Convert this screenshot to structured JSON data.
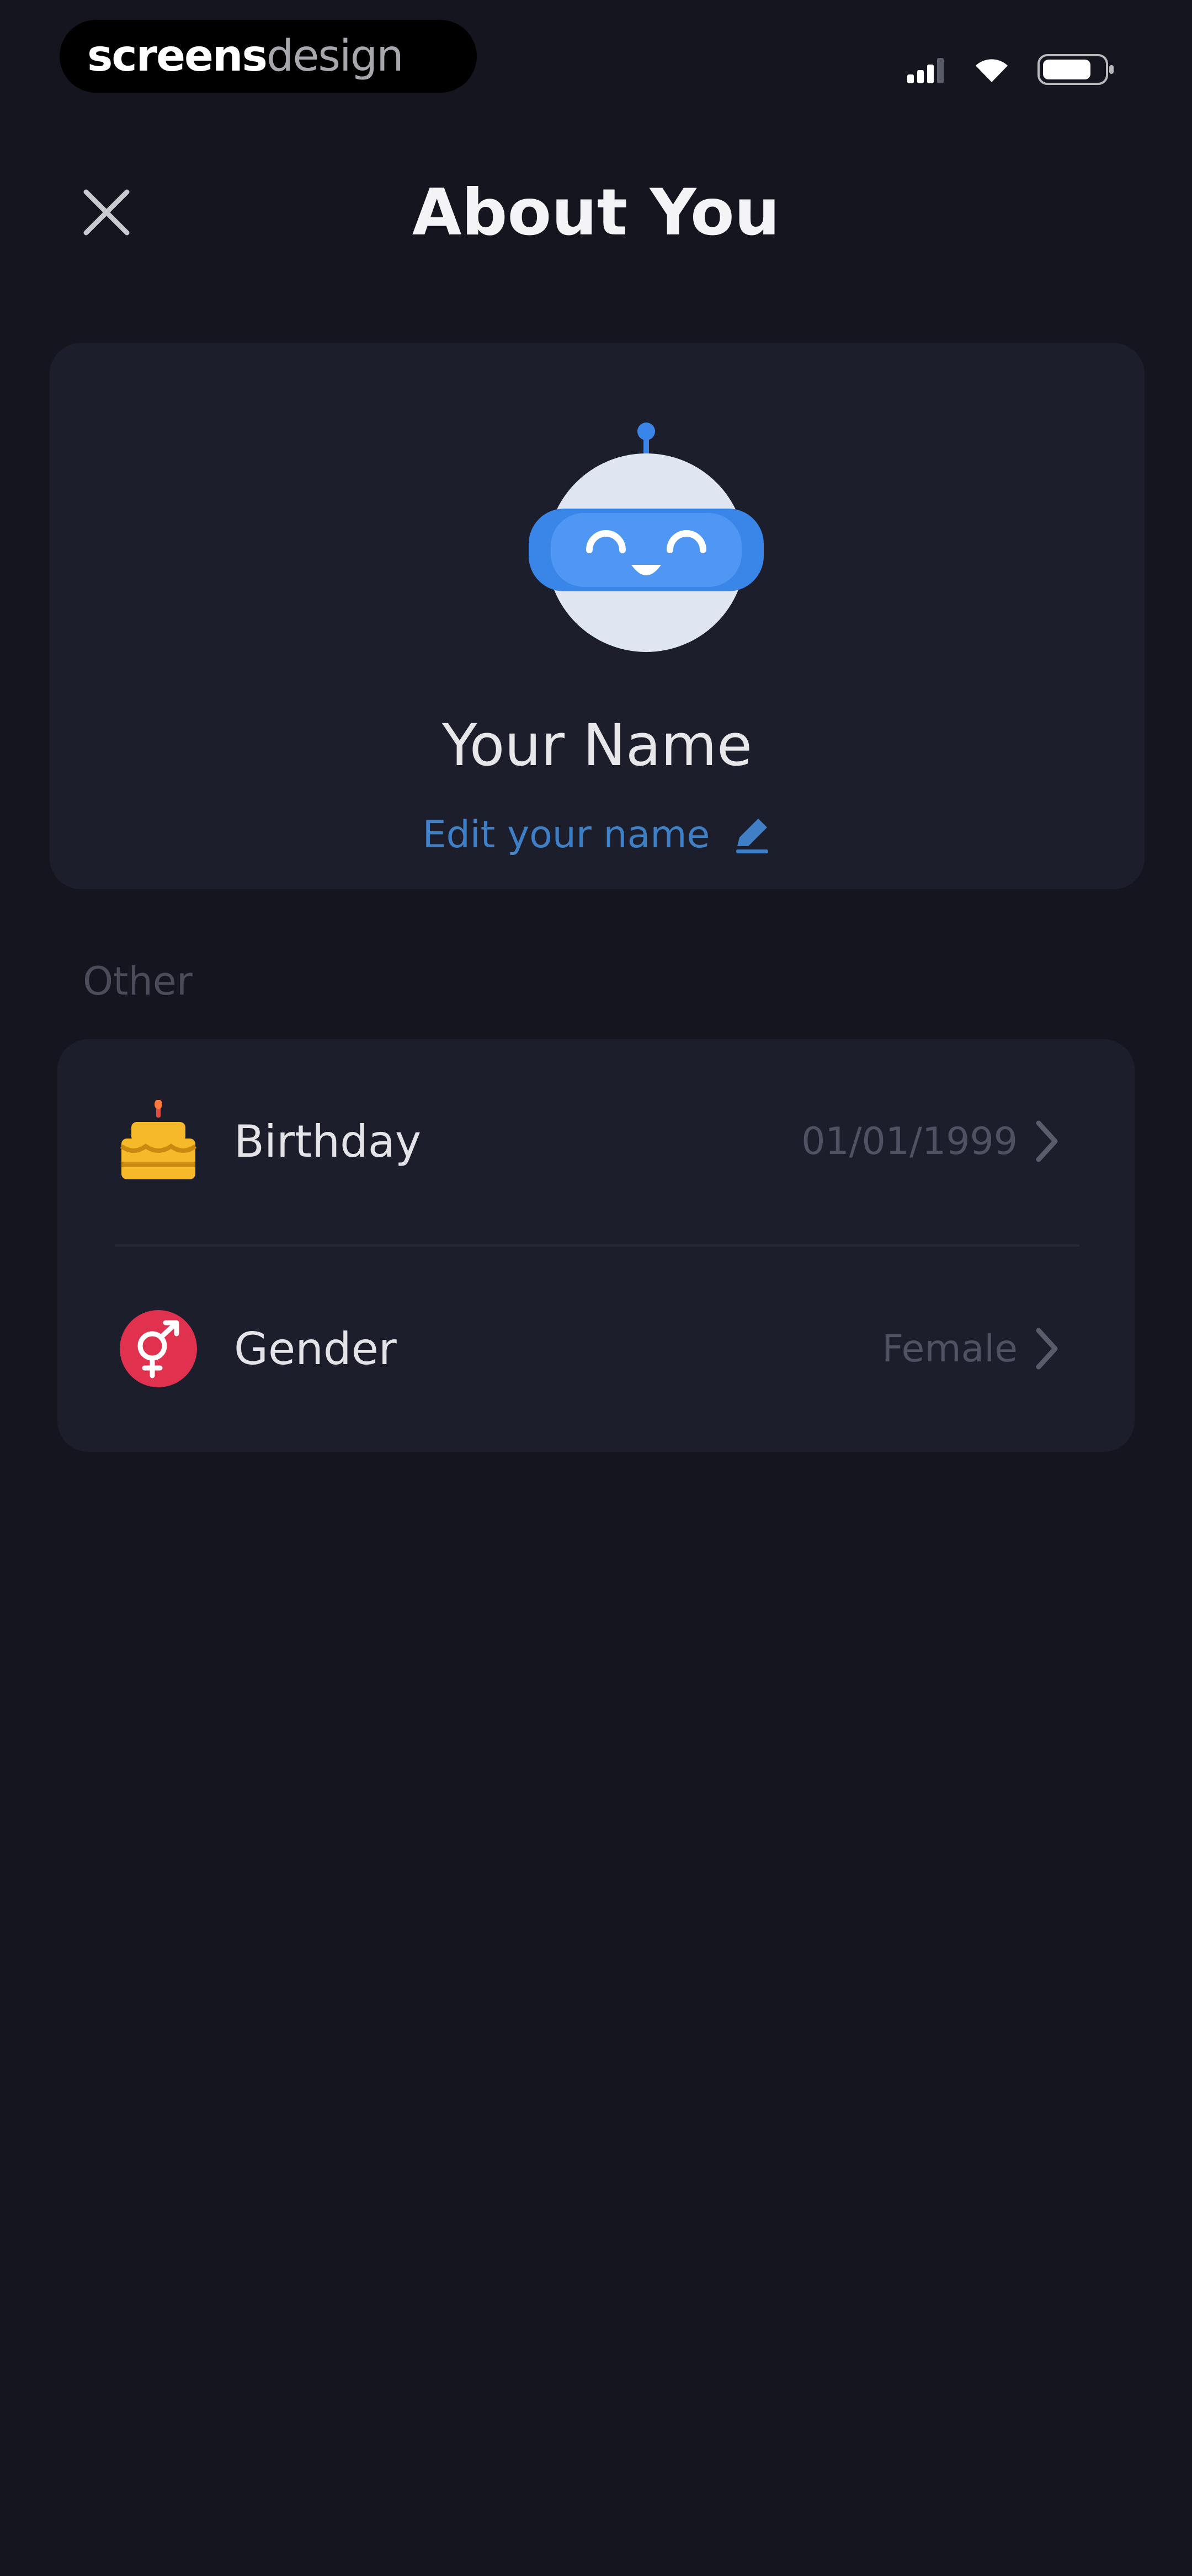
{
  "status_bar": {
    "brand_part1": "screens",
    "brand_part2": "design",
    "icons": [
      "signal-icon",
      "wifi-icon",
      "battery-icon"
    ]
  },
  "header": {
    "title": "About You",
    "close_icon": "close-icon"
  },
  "profile": {
    "name": "Your Name",
    "edit_label": "Edit your name",
    "edit_icon": "pencil-icon",
    "avatar_icon": "robot-avatar"
  },
  "other": {
    "section_label": "Other",
    "rows": [
      {
        "icon": "birthday-cake-icon",
        "label": "Birthday",
        "value": "01/01/1999"
      },
      {
        "icon": "gender-icon",
        "label": "Gender",
        "value": "Female"
      }
    ]
  },
  "colors": {
    "background": "#14151f",
    "card": "#1c1e2b",
    "accent_blue": "#3f7fc6",
    "cake_yellow": "#f5b92a",
    "gender_red": "#e0324f"
  }
}
